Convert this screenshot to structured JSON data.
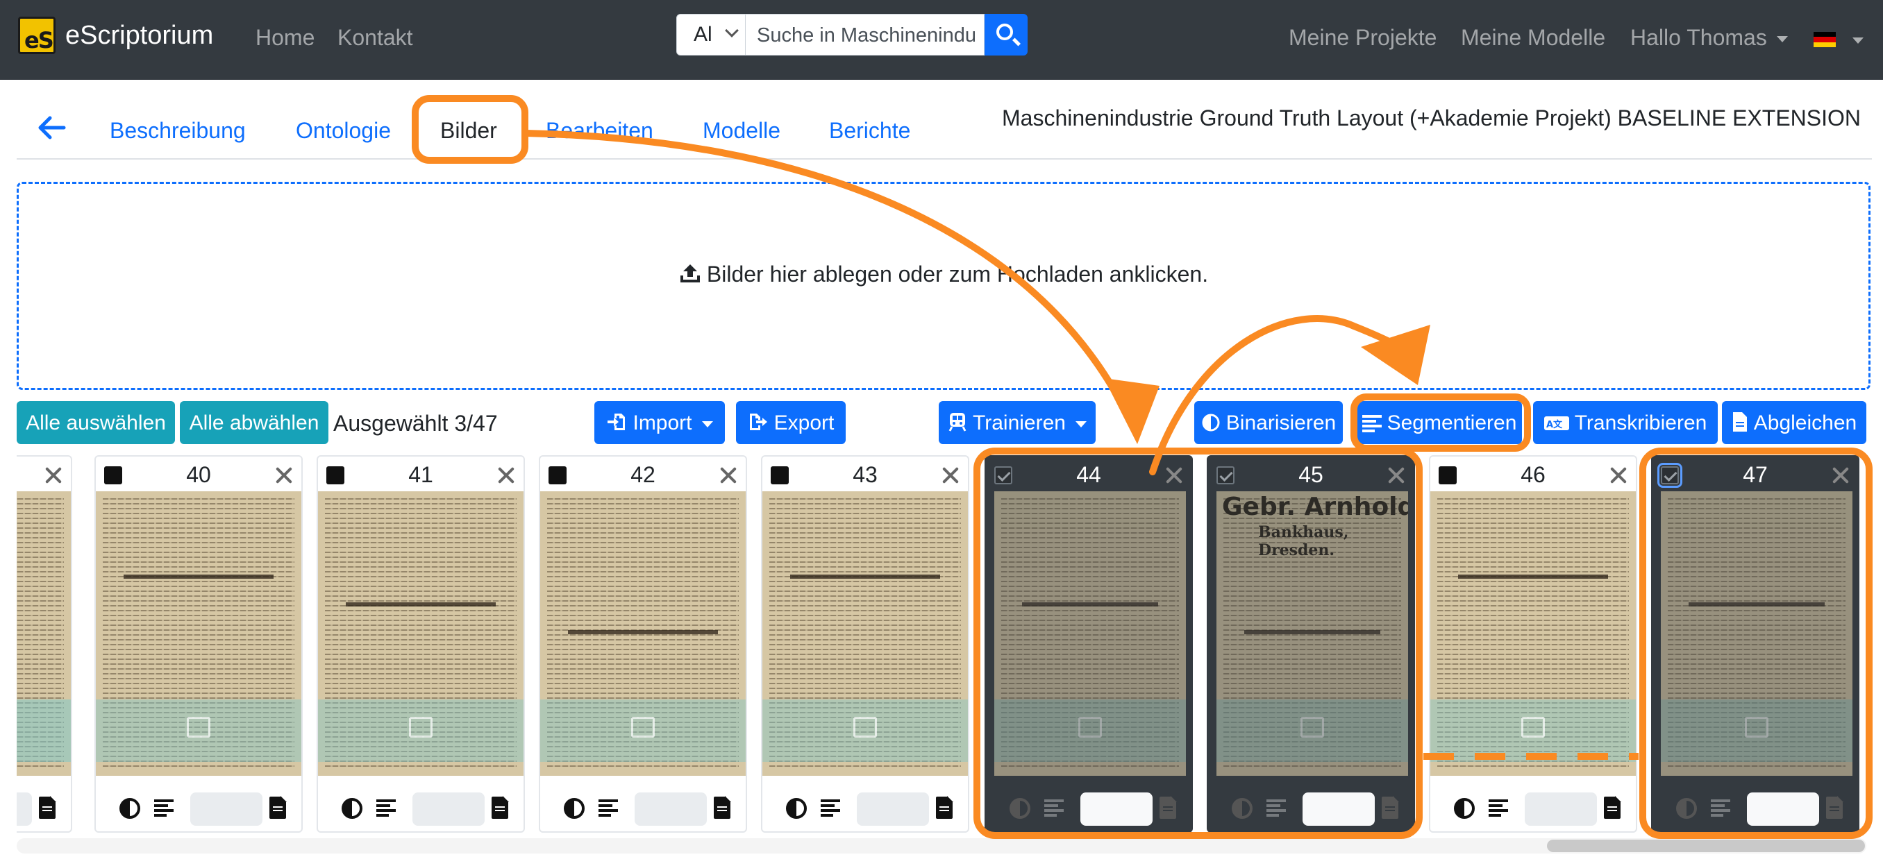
{
  "navbar": {
    "brand_logo_text": "eS",
    "brand": "eScriptorium",
    "links": [
      "Home",
      "Kontakt"
    ],
    "search": {
      "scope": "Al",
      "value": "Suche in Maschinenindu"
    },
    "right_links": [
      "Meine Projekte",
      "Meine Modelle",
      "Hallo Thomas"
    ],
    "flag_colors": [
      "#000000",
      "#dd0000",
      "#ffce00"
    ]
  },
  "tabs": [
    "Beschreibung",
    "Ontologie",
    "Bilder",
    "Bearbeiten",
    "Modelle",
    "Berichte"
  ],
  "active_tab": "Bilder",
  "project_title": "Maschinenindustrie Ground Truth Layout (+Akademie Projekt) BASELINE EXTENSION",
  "dropzone": {
    "text": "Bilder hier ablegen oder zum Hochladen anklicken."
  },
  "toolbar": {
    "select_all": "Alle auswählen",
    "deselect_all": "Alle abwählen",
    "selected_count": "Ausgewählt 3/47",
    "import": "Import",
    "export": "Export",
    "train": "Trainieren",
    "binarize": "Binarisieren",
    "segment": "Segmentieren",
    "transcribe": "Transkribieren",
    "align": "Abgleichen"
  },
  "cards": [
    {
      "number": "40",
      "selected": false
    },
    {
      "number": "41",
      "selected": false
    },
    {
      "number": "42",
      "selected": false
    },
    {
      "number": "43",
      "selected": false
    },
    {
      "number": "44",
      "selected": true
    },
    {
      "number": "45",
      "selected": true
    },
    {
      "number": "46",
      "selected": false
    },
    {
      "number": "47",
      "selected": true
    }
  ],
  "thumb_text": {
    "card45_title": "Gebr. Arnhold,",
    "card45_subtitle": "Bankhaus, Dresden."
  },
  "colors": {
    "navbar": "#343a40",
    "primary": "#0d6efd",
    "teal": "#17a2b8",
    "annotation": "#fa8a22"
  }
}
